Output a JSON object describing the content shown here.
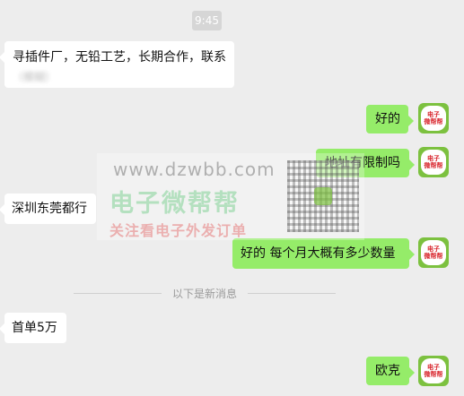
{
  "chat": {
    "timestamp": "9:45",
    "messages": [
      {
        "side": "left",
        "text": "寻插件厂，无铅工艺，长期合作，联系",
        "extra": "（模糊）"
      },
      {
        "side": "right",
        "text": "好的"
      },
      {
        "side": "right",
        "text": "地址有限制吗"
      },
      {
        "side": "left",
        "text": "深圳东莞都行"
      },
      {
        "side": "right",
        "text": "好的  每个月大概有多少数量"
      },
      {
        "side": "left",
        "text": "首单5万"
      },
      {
        "side": "right",
        "text": "欧克"
      }
    ],
    "divider": "以下是新消息"
  },
  "avatar": {
    "line1": "电子",
    "line2": "微帮帮"
  },
  "watermark": {
    "url": "www.dzwbb.com",
    "brand": "电子微帮帮",
    "slogan": "关注看电子外发订单"
  }
}
